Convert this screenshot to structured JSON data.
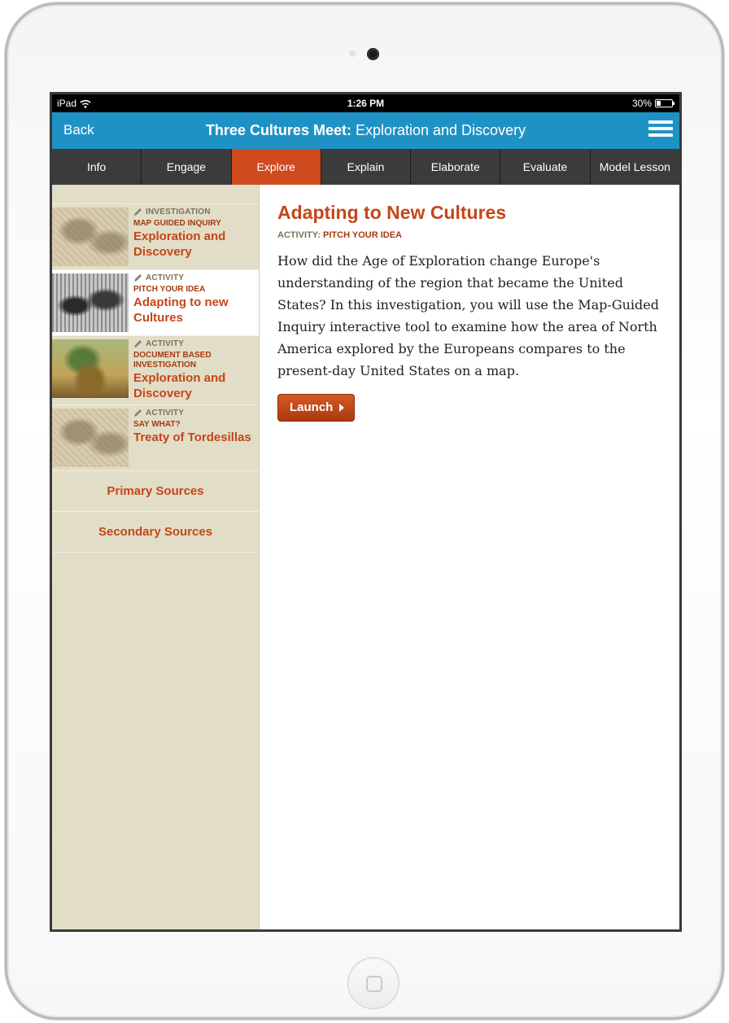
{
  "statusbar": {
    "device": "iPad",
    "time": "1:26 PM",
    "battery": "30%",
    "battery_level": 0.3
  },
  "header": {
    "back_label": "Back",
    "title_bold": "Three Cultures Meet:",
    "title_rest": " Exploration and Discovery"
  },
  "tabs": [
    {
      "label": "Info",
      "active": false
    },
    {
      "label": "Engage",
      "active": false
    },
    {
      "label": "Explore",
      "active": true
    },
    {
      "label": "Explain",
      "active": false
    },
    {
      "label": "Elaborate",
      "active": false
    },
    {
      "label": "Evaluate",
      "active": false
    },
    {
      "label": "Model Lesson",
      "active": false
    }
  ],
  "sidebar": {
    "items": [
      {
        "kind": "INVESTIGATION",
        "sub": "MAP GUIDED INQUIRY",
        "name": "Exploration and Discovery",
        "thumb": "map"
      },
      {
        "kind": "ACTIVITY",
        "sub": "PITCH YOUR IDEA",
        "name": "Adapting to new Cultures",
        "thumb": "engraving",
        "selected": true
      },
      {
        "kind": "ACTIVITY",
        "sub": "DOCUMENT BASED INVESTIGATION",
        "name": "Exploration and Discovery",
        "thumb": "painting"
      },
      {
        "kind": "ACTIVITY",
        "sub": "SAY WHAT?",
        "name": "Treaty of Tordesillas",
        "thumb": "map"
      }
    ],
    "links": [
      "Primary Sources",
      "Secondary Sources"
    ]
  },
  "main": {
    "heading": "Adapting to New Cultures",
    "activity_label": "ACTIVITY: ",
    "activity_value": "PITCH YOUR IDEA",
    "description": "How did the Age of Exploration change Europe's understanding of the region that became the United States? In this investigation, you will use the Map-Guided Inquiry interactive tool to examine how the area of North America explored by the Europeans compares to the present-day United States on a map.",
    "launch_label": "Launch"
  },
  "colors": {
    "accent": "#c4461a",
    "header": "#1f92c5",
    "sidebar": "#e2ddc6",
    "active_tab": "#cf4a1f"
  }
}
